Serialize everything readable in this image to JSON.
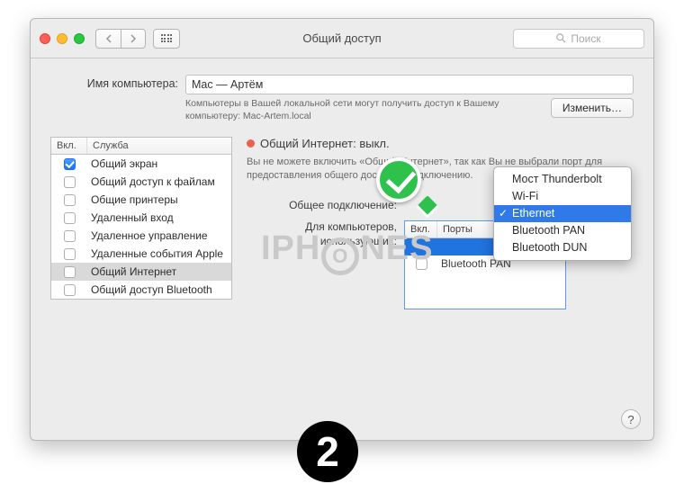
{
  "titlebar": {
    "title": "Общий доступ"
  },
  "search": {
    "placeholder": "Поиск"
  },
  "computer_name": {
    "label": "Имя компьютера:",
    "value": "Mac — Артём",
    "hint": "Компьютеры в Вашей локальной сети могут получить доступ к Вашему компьютеру: Mac-Artem.local",
    "edit_button": "Изменить…"
  },
  "services": {
    "head_on": "Вкл.",
    "head_name": "Служба",
    "items": [
      {
        "on": true,
        "name": "Общий экран"
      },
      {
        "on": false,
        "name": "Общий доступ к файлам"
      },
      {
        "on": false,
        "name": "Общие принтеры"
      },
      {
        "on": false,
        "name": "Удаленный вход"
      },
      {
        "on": false,
        "name": "Удаленное управление"
      },
      {
        "on": false,
        "name": "Удаленные события Apple"
      },
      {
        "on": false,
        "name": "Общий Интернет",
        "selected": true
      },
      {
        "on": false,
        "name": "Общий доступ Bluetooth"
      }
    ]
  },
  "detail": {
    "title": "Общий Интернет: выкл.",
    "hint": "Вы не можете включить «Общий Интернет», так как Вы не выбрали порт для предоставления общего доступа к подключению.",
    "share_from_label": "Общее подключение:",
    "to_ports_label": "Для компьютеров, использующих:",
    "port_head_on": "Вкл.",
    "port_head_name": "Порты",
    "port_items": [
      {
        "on": false,
        "name": "Bluetooth PAN"
      }
    ]
  },
  "dropdown": {
    "items": [
      {
        "label": "Мост Thunderbolt"
      },
      {
        "label": "Wi-Fi"
      },
      {
        "label": "Ethernet",
        "selected": true
      },
      {
        "label": "Bluetooth PAN"
      },
      {
        "label": "Bluetooth DUN"
      }
    ]
  },
  "watermark": {
    "pre": "IPH",
    "mid": "O",
    "post": "NES"
  },
  "step": "2",
  "help": "?"
}
